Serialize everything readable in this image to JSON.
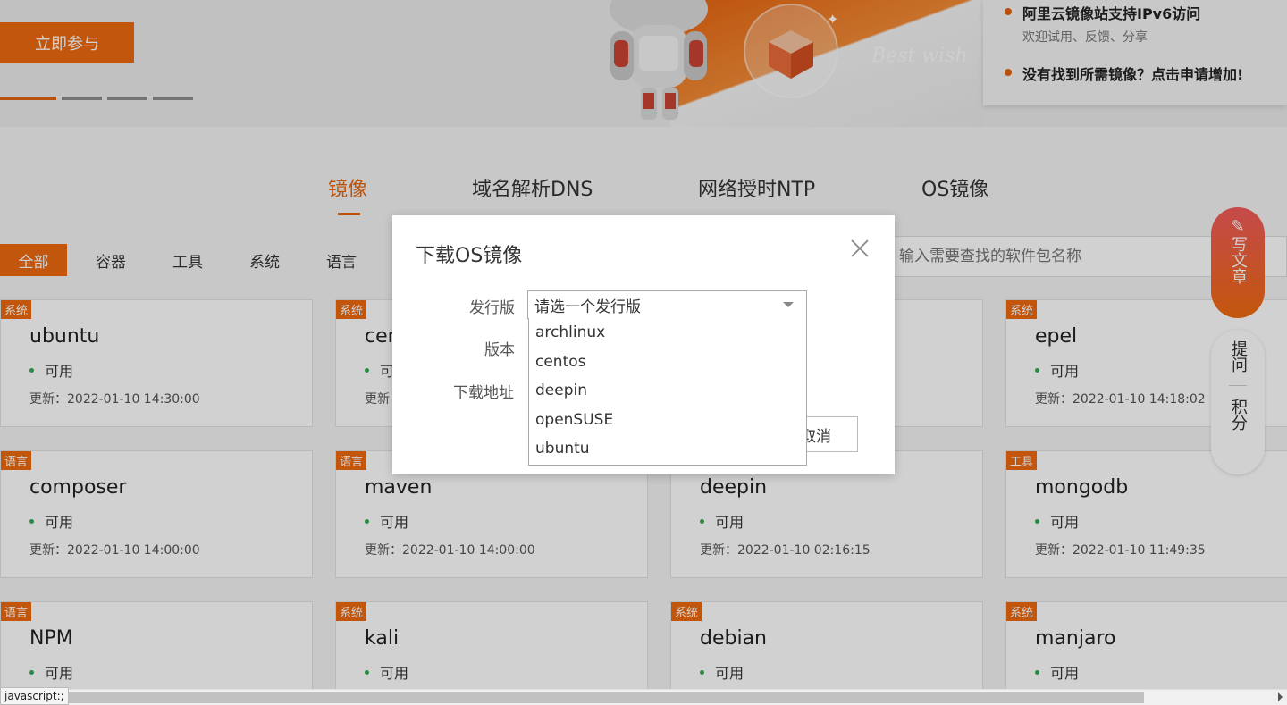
{
  "banner": {
    "join_button": "立即参与",
    "hero_script": "Best wish",
    "notice": {
      "title1": "阿里云镜像站支持IPv6访问",
      "sub1": "欢迎试用、反馈、分享",
      "title2": "没有找到所需镜像？点击申请增加!"
    }
  },
  "tabs": [
    "镜像",
    "域名解析DNS",
    "网络授时NTP",
    "OS镜像"
  ],
  "categories": [
    "全部",
    "容器",
    "工具",
    "系统",
    "语言"
  ],
  "search": {
    "placeholder": "输入需要查找的软件包名称"
  },
  "cards": [
    {
      "tag": "系统",
      "name": "ubuntu",
      "status": "可用",
      "updated": "更新：2022-01-10 14:30:00"
    },
    {
      "tag": "系统",
      "name": "cen",
      "status": "可",
      "updated": "更新"
    },
    {
      "tag": "系统",
      "name": "epel",
      "status": "可用",
      "updated": "更新：2022-01-10 14:18:02"
    },
    {
      "tag": "语言",
      "name": "composer",
      "status": "可用",
      "updated": "更新：2022-01-10 14:00:00"
    },
    {
      "tag": "语言",
      "name": "maven",
      "status": "可用",
      "updated": "更新：2022-01-10 14:00:00"
    },
    {
      "tag": "",
      "name": "deepin",
      "status": "可用",
      "updated": "更新：2022-01-10 02:16:15"
    },
    {
      "tag": "工具",
      "name": "mongodb",
      "status": "可用",
      "updated": "更新：2022-01-10 11:49:35"
    },
    {
      "tag": "语言",
      "name": "NPM",
      "status": "可用",
      "updated": ""
    },
    {
      "tag": "系统",
      "name": "kali",
      "status": "可用",
      "updated": ""
    },
    {
      "tag": "系统",
      "name": "debian",
      "status": "可用",
      "updated": ""
    },
    {
      "tag": "系统",
      "name": "manjaro",
      "status": "可用",
      "updated": ""
    }
  ],
  "float": {
    "write": "写文章",
    "ask": "提问",
    "points": "积分"
  },
  "modal": {
    "title": "下载OS镜像",
    "label_distro": "发行版",
    "label_version": "版本",
    "label_url": "下载地址",
    "select_placeholder": "请选一个发行版",
    "options": [
      "archlinux",
      "centos",
      "deepin",
      "openSUSE",
      "ubuntu"
    ],
    "cancel": "取消"
  },
  "status_url": "javascript:;",
  "colors": {
    "accent": "#ee6a10",
    "available": "#36a852"
  }
}
